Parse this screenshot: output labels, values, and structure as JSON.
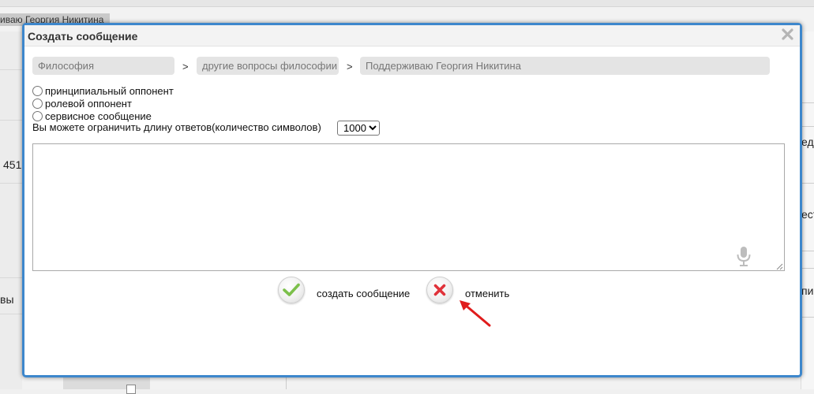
{
  "background": {
    "breadcrumb_fragment": "иваю Георгия Никитина",
    "left_number": "451",
    "left_text": "вы",
    "right_fragments": [
      "едо",
      "ест",
      "пи"
    ]
  },
  "dialog": {
    "title": "Создать сообщение",
    "close_icon": "close-x-icon"
  },
  "path": {
    "category": "Философия",
    "subcategory": "другие вопросы философии",
    "topic": "Поддерживаю Георгия Никитина",
    "separator": ">"
  },
  "roles": {
    "options": [
      {
        "label": "принципиальный оппонент",
        "checked": false
      },
      {
        "label": "ролевой оппонент",
        "checked": false
      },
      {
        "label": "сервисное сообщение",
        "checked": false
      }
    ]
  },
  "limit": {
    "label": "Вы можете ограничить длину ответов(количество символов)",
    "selected": "1000"
  },
  "message": {
    "value": "",
    "mic_icon": "microphone-icon"
  },
  "actions": {
    "create_label": "создать сообщение",
    "create_icon": "check-icon",
    "cancel_label": "отменить",
    "cancel_icon": "x-icon"
  },
  "colors": {
    "dialog_border": "#3d87cc",
    "check_green": "#7cc04b",
    "cancel_red": "#e0323a",
    "annotation_arrow": "#e01c1c"
  }
}
